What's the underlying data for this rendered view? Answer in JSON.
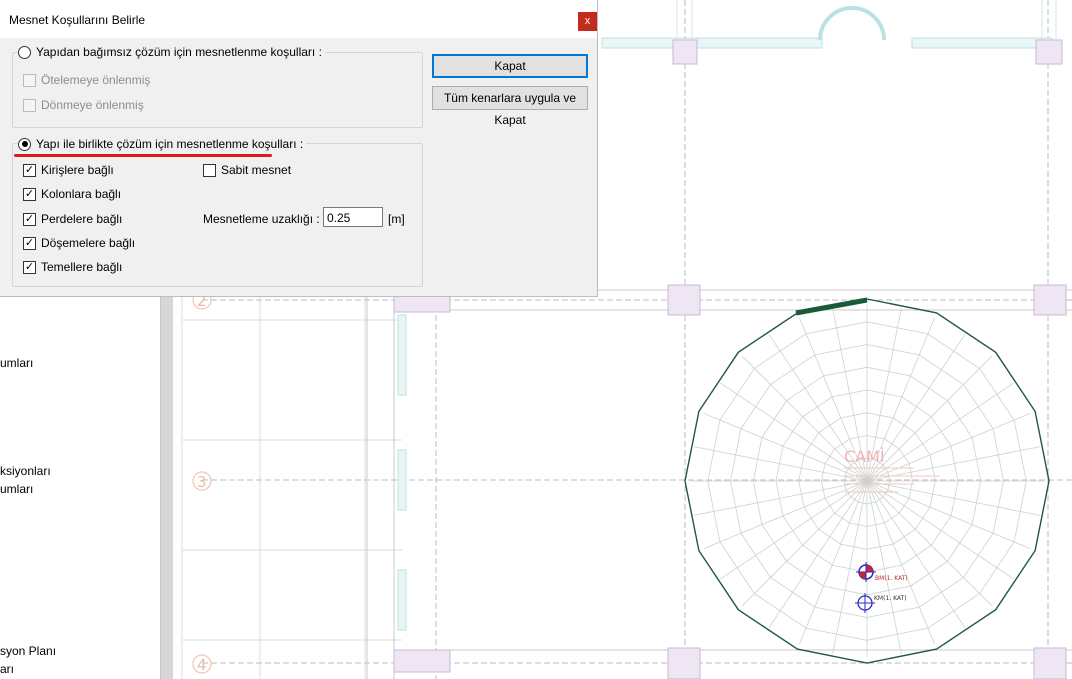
{
  "dialog": {
    "title": "Mesnet Koşullarını Belirle",
    "close_label": "x",
    "option_independent": {
      "label": "Yapıdan bağımsız çözüm için mesnetlenme koşulları  :",
      "checked": false,
      "checks": [
        {
          "label": "Ötelemeye önlenmiş",
          "checked": false
        },
        {
          "label": "Dönmeye önlenmiş",
          "checked": false
        }
      ]
    },
    "option_with_structure": {
      "label": "Yapı ile birlikte çözüm için mesnetlenme koşulları  :",
      "checked": true,
      "checks": [
        {
          "label": "Kirişlere bağlı",
          "checked": true
        },
        {
          "label": "Kolonlara bağlı",
          "checked": true
        },
        {
          "label": "Perdelere bağlı",
          "checked": true
        },
        {
          "label": "Döşemelere bağlı",
          "checked": true
        },
        {
          "label": "Temellere bağlı",
          "checked": true
        }
      ],
      "fixed_support": {
        "label": "Sabit mesnet",
        "checked": false
      },
      "distance_label": "Mesnetleme uzaklığı :",
      "distance_value": "0.25",
      "distance_unit": "[m]"
    },
    "buttons": {
      "close": "Kapat",
      "apply_all": "Tüm kenarlara uygula ve Kapat"
    }
  },
  "left_panel": {
    "items": [
      "umları",
      "ksiyonları",
      "umları",
      "syon Planı",
      "arı"
    ]
  },
  "drawing": {
    "axis_labels": [
      "2",
      "3",
      "4"
    ],
    "room_label": "CAMİ",
    "marker_labels": [
      "BM(1. KAT)",
      "KM(1. KAT)"
    ],
    "colors": {
      "outline": "#1f5a3c",
      "grid": "#d3d3d3",
      "support_mark": "#d21f2b",
      "column": "#e9dff0"
    }
  }
}
